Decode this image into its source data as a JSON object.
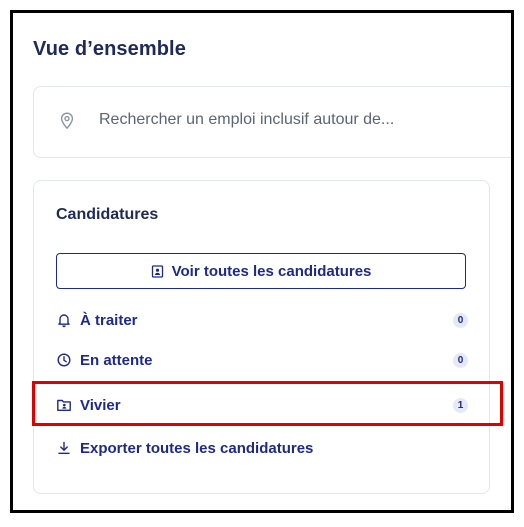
{
  "page": {
    "title": "Vue d’ensemble"
  },
  "search": {
    "placeholder": "Rechercher un emploi inclusif autour de..."
  },
  "candidatures": {
    "title": "Candidatures",
    "see_all_label": "Voir toutes les candidatures",
    "items": [
      {
        "label": "À traiter",
        "count": "0",
        "icon": "bell-icon"
      },
      {
        "label": "En attente",
        "count": "0",
        "icon": "clock-icon"
      },
      {
        "label": "Vivier",
        "count": "1",
        "icon": "folder-user-icon"
      }
    ],
    "export_label": "Exporter toutes les candidatures"
  },
  "colors": {
    "primary": "#1e2a8a",
    "title": "#1e2a5a",
    "badge_bg": "#e4e9f5",
    "highlight": "#e00000"
  }
}
